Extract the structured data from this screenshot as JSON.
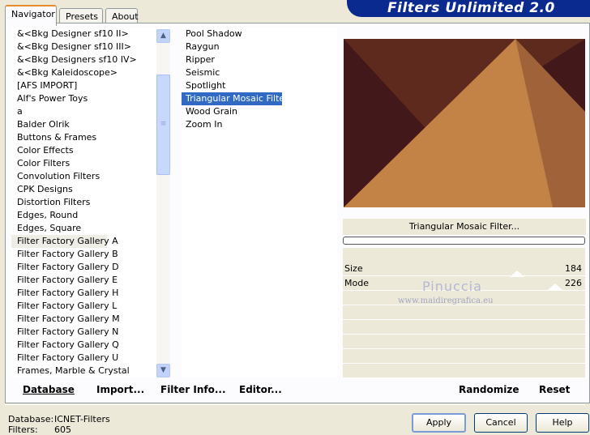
{
  "app": {
    "title": "Filters Unlimited 2.0"
  },
  "tabs": [
    {
      "label": "Navigator",
      "active": true
    },
    {
      "label": "Presets",
      "active": false
    },
    {
      "label": "About",
      "active": false
    }
  ],
  "categories": [
    "&<Bkg Designer sf10 II>",
    "&<Bkg Designer sf10 III>",
    "&<Bkg Designers sf10 IV>",
    "&<Bkg Kaleidoscope>",
    "[AFS IMPORT]",
    "Alf's Power Toys",
    "a",
    "Balder Olrik",
    "Buttons & Frames",
    "Color Effects",
    "Color Filters",
    "Convolution Filters",
    "CPK Designs",
    "Distortion Filters",
    "Edges, Round",
    "Edges, Square",
    "Filter Factory Gallery A",
    "Filter Factory Gallery B",
    "Filter Factory Gallery D",
    "Filter Factory Gallery E",
    "Filter Factory Gallery H",
    "Filter Factory Gallery L",
    "Filter Factory Gallery M",
    "Filter Factory Gallery N",
    "Filter Factory Gallery Q",
    "Filter Factory Gallery U",
    "Frames, Marble & Crystal"
  ],
  "selected_category": "Filter Factory Gallery A",
  "filters": [
    "Pool Shadow",
    "Raygun",
    "Ripper",
    "Seismic",
    "Spotlight",
    "Triangular Mosaic Filter...",
    "Wood Grain",
    "Zoom In"
  ],
  "selected_filter": "Triangular Mosaic Filter...",
  "preview": {
    "filter_name": "Triangular Mosaic Filter...",
    "colors": {
      "dark": "#43181a",
      "mid": "#5e2a1d",
      "light": "#c38346",
      "side": "#a06238"
    }
  },
  "params": [
    {
      "label": "Size",
      "value": "184"
    },
    {
      "label": "Mode",
      "value": "226"
    }
  ],
  "watermark": {
    "name": "Pinuccia",
    "url": "www.maidiregrafica.eu"
  },
  "commands": {
    "database": "Database",
    "import": "Import...",
    "filter_info": "Filter Info...",
    "editor": "Editor...",
    "randomize": "Randomize",
    "reset": "Reset"
  },
  "info": {
    "database_label": "Database:",
    "database_value": "ICNET-Filters",
    "filters_label": "Filters:",
    "filters_value": "605"
  },
  "buttons": {
    "apply": "Apply",
    "cancel": "Cancel",
    "help": "Help"
  }
}
